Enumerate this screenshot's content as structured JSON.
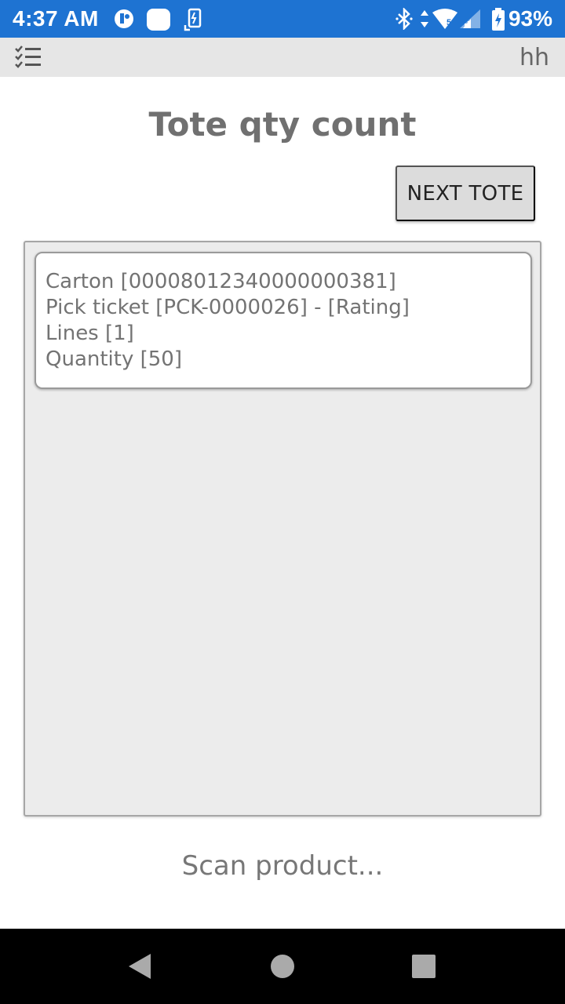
{
  "status_bar": {
    "time": "4:37 AM",
    "battery": "93%",
    "bg_color": "#1e73d2",
    "icons": [
      "app-notification-icon",
      "app-notification-icon-2",
      "download-icon",
      "bluetooth-icon",
      "data-transfer-icon",
      "wifi-icon",
      "signal-icon",
      "battery-charging-icon"
    ]
  },
  "top_bar": {
    "menu_icon": "checklist-menu-icon",
    "user": "hh"
  },
  "page": {
    "title": "Tote qty count",
    "next_tote_label": "NEXT TOTE",
    "scan_prompt": "Scan product..."
  },
  "carton": {
    "carton_line": "Carton [00008012340000000381]",
    "pick_ticket_line": "Pick ticket [PCK-0000026] - [Rating]",
    "lines_line": "Lines [1]",
    "quantity_line": "Quantity [50]"
  },
  "nav_bar": {
    "icons": [
      "back-icon",
      "home-icon",
      "recents-icon"
    ]
  }
}
